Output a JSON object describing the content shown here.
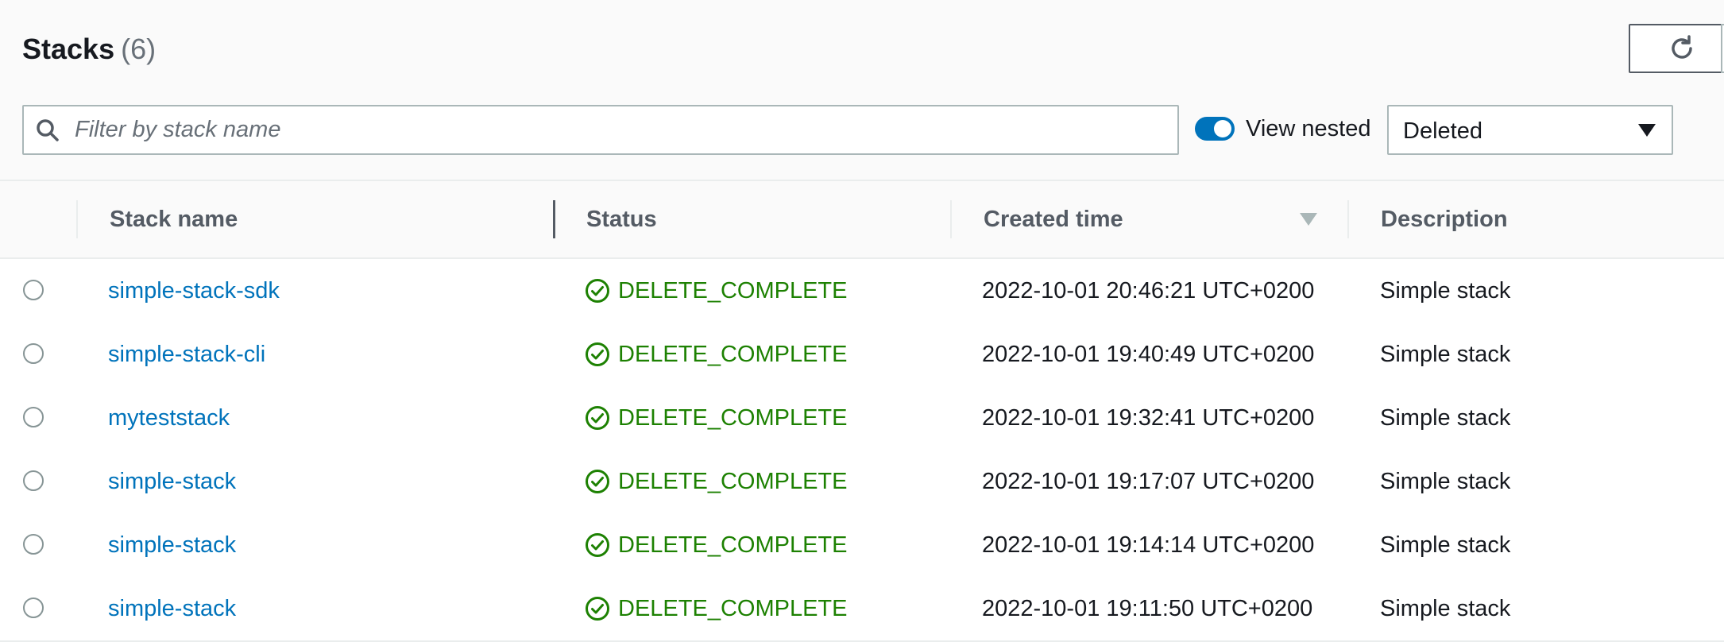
{
  "header": {
    "title": "Stacks",
    "count": "(6)",
    "refresh_icon": "refresh-icon"
  },
  "filter": {
    "placeholder": "Filter by stack name",
    "search_icon": "search-icon"
  },
  "view_nested": {
    "label": "View nested",
    "enabled": true
  },
  "status_filter": {
    "selected": "Deleted"
  },
  "table": {
    "columns": [
      "Stack name",
      "Status",
      "Created time",
      "Description"
    ],
    "sort_column": "Created time",
    "rows": [
      {
        "name": "simple-stack-sdk",
        "status": "DELETE_COMPLETE",
        "created": "2022-10-01 20:46:21 UTC+0200",
        "description": "Simple stack"
      },
      {
        "name": "simple-stack-cli",
        "status": "DELETE_COMPLETE",
        "created": "2022-10-01 19:40:49 UTC+0200",
        "description": "Simple stack"
      },
      {
        "name": "myteststack",
        "status": "DELETE_COMPLETE",
        "created": "2022-10-01 19:32:41 UTC+0200",
        "description": "Simple stack"
      },
      {
        "name": "simple-stack",
        "status": "DELETE_COMPLETE",
        "created": "2022-10-01 19:17:07 UTC+0200",
        "description": "Simple stack"
      },
      {
        "name": "simple-stack",
        "status": "DELETE_COMPLETE",
        "created": "2022-10-01 19:14:14 UTC+0200",
        "description": "Simple stack"
      },
      {
        "name": "simple-stack",
        "status": "DELETE_COMPLETE",
        "created": "2022-10-01 19:11:50 UTC+0200",
        "description": "Simple stack"
      }
    ]
  },
  "colors": {
    "link": "#0073bb",
    "success": "#1d8102",
    "toggle_on": "#0073bb"
  }
}
